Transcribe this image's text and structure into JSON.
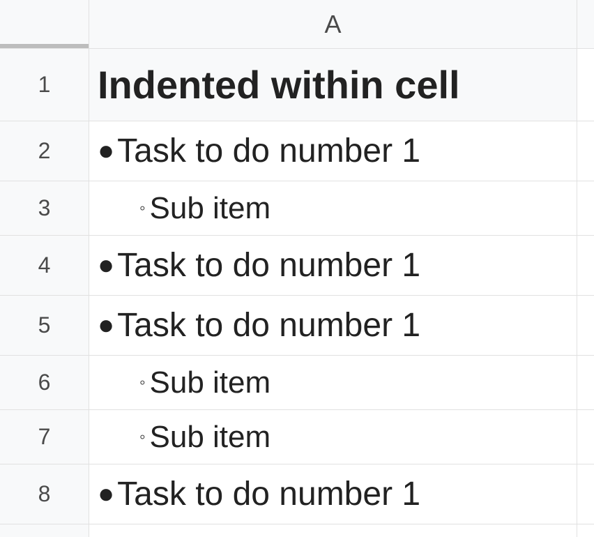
{
  "columns": {
    "A": "A"
  },
  "rows": {
    "1": {
      "num": "1",
      "value": "Indented within cell",
      "style": "header"
    },
    "2": {
      "num": "2",
      "value": "Task to do number 1",
      "style": "bullet"
    },
    "3": {
      "num": "3",
      "value": "Sub item",
      "style": "sub"
    },
    "4": {
      "num": "4",
      "value": "Task to do number 1",
      "style": "bullet"
    },
    "5": {
      "num": "5",
      "value": "Task to do number 1",
      "style": "bullet"
    },
    "6": {
      "num": "6",
      "value": "Sub item",
      "style": "sub"
    },
    "7": {
      "num": "7",
      "value": "Sub item",
      "style": "sub"
    },
    "8": {
      "num": "8",
      "value": "Task to do number 1",
      "style": "bullet"
    }
  },
  "glyphs": {
    "bullet": "●",
    "circle": "◦"
  }
}
